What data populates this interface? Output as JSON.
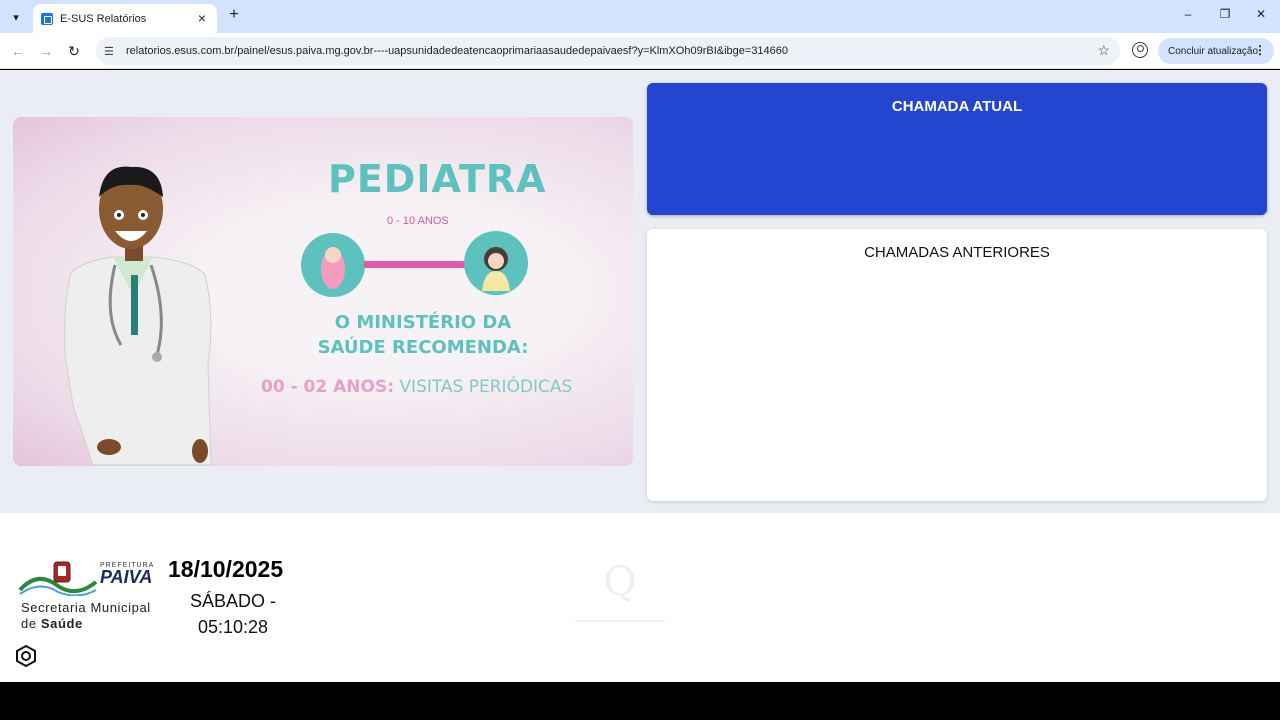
{
  "browser": {
    "tab_title": "E-SUS Relatórios",
    "url": "relatorios.esus.com.br/painel/esus.paiva.mg.gov.br----uapsunidadedeatencaoprimariaasaudedepaivaesf?y=KlmXOh09rBI&ibge=314660",
    "update_label": "Concluir atualização"
  },
  "hero": {
    "title": "PEDIATRA",
    "age_range": "0 - 10 ANOS",
    "recommend": "O MINISTÉRIO DA SAÚDE RECOMENDA:",
    "visits_age": "00 - 02 ANOS:",
    "visits_text": " VISITAS PERIÓDICAS",
    "colors": {
      "teal": "#5dc1be",
      "pink": "#e05aa6"
    }
  },
  "panel": {
    "current_title": "CHAMADA ATUAL",
    "previous_title": "CHAMADAS ANTERIORES",
    "accent": "#2345d0"
  },
  "footer": {
    "logo_prefeitura": "PREFEITURA",
    "logo_name": "PAIVA",
    "logo_org_line1": "Secretaria Municipal",
    "logo_org_prefix": "de ",
    "logo_org_bold": "Saúde",
    "date": "18/10/2025",
    "weekday": "SÁBADO -",
    "time": "05:10:28"
  }
}
